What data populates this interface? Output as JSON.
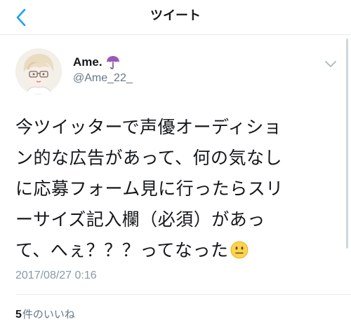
{
  "header": {
    "title": "ツイート",
    "back_icon": "chevron-left-icon"
  },
  "user": {
    "display_name": "Ame.",
    "name_emoji": "umbrella-icon",
    "handle": "@Ame_22_"
  },
  "tweet": {
    "lines": [
      "今ツイッターで声優オーディショ",
      "ン的な広告があって、何の気なし",
      "に応募フォーム見に行ったらスリ",
      "ーサイズ記入欄（必須）があっ",
      "て、へぇ？？？ってなった"
    ],
    "trailing_emoji": "neutral-face-emoji",
    "timestamp": "2017/08/27 0:16"
  },
  "stats": {
    "likes_count": "5",
    "likes_label": "件のいいね"
  },
  "colors": {
    "accent": "#1da1f2",
    "text": "#14171a",
    "secondary": "#657786",
    "divider": "#e6ecf0"
  }
}
